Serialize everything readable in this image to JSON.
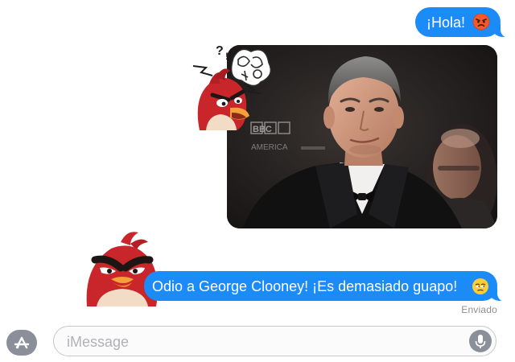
{
  "conversation": {
    "messages": [
      {
        "text": "¡Hola!",
        "emoji": "angry-face-emoji"
      },
      {
        "type": "photo",
        "description_icon": "photo-portrait-man-tuxedo"
      },
      {
        "text": "Odio a George Clooney! ¡Es demasiado guapo!",
        "emoji": "unamused-face-emoji"
      }
    ],
    "status": "Enviado"
  },
  "photo": {
    "backdrop_text": "BBC",
    "backdrop_text_2": "AMERICA"
  },
  "stickers": [
    "angry-bird-red-sticker-shouting",
    "angry-bird-red-sticker-frowning"
  ],
  "input": {
    "placeholder": "iMessage"
  },
  "colors": {
    "bubble_blue": "#1b8bf8",
    "status_gray": "#8e8e93",
    "bird_red": "#c8262b"
  }
}
